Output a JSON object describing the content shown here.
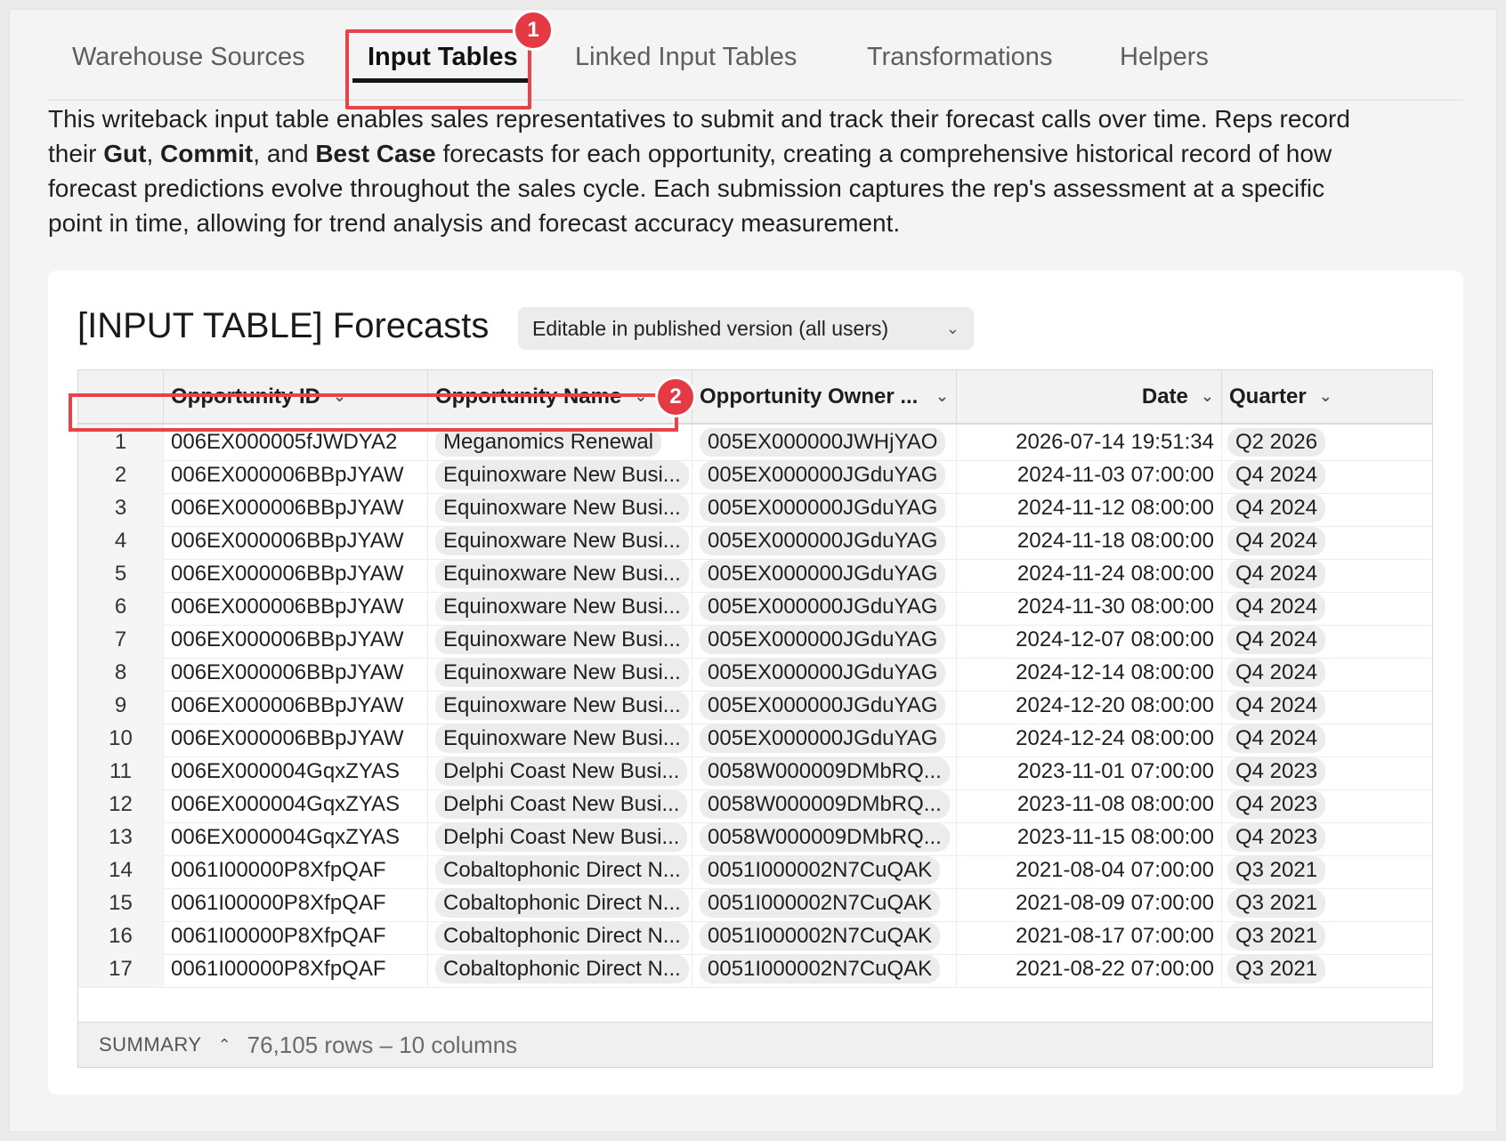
{
  "tabs": [
    {
      "label": "Warehouse Sources"
    },
    {
      "label": "Input Tables"
    },
    {
      "label": "Linked Input Tables"
    },
    {
      "label": "Transformations"
    },
    {
      "label": "Helpers"
    }
  ],
  "annotations": {
    "badge1": "1",
    "badge2": "2"
  },
  "description": {
    "line1": "This writeback input table enables sales representatives to submit and track their forecast calls over time. Reps record",
    "line2_pre": "their ",
    "gut": "Gut",
    "comma": ", ",
    "commit": "Commit",
    "and": ", and ",
    "best_case": "Best Case",
    "line2_post": " forecasts for each opportunity, creating a comprehensive historical record of how",
    "line3": "forecast predictions evolve throughout the sales cycle. Each submission captures the rep's assessment at a specific",
    "line4": "point in time, allowing for trend analysis and forecast accuracy measurement."
  },
  "card": {
    "title": "[INPUT TABLE] Forecasts",
    "permission": "Editable in published version (all users)"
  },
  "table": {
    "columns": [
      "Opportunity ID",
      "Opportunity Name",
      "Opportunity Owner ...",
      "Date",
      "Quarter"
    ],
    "rows": [
      [
        "1",
        "006EX000005fJWDYA2",
        "Meganomics Renewal",
        "005EX000000JWHjYAO",
        "2026-07-14 19:51:34",
        "Q2 2026"
      ],
      [
        "2",
        "006EX000006BBpJYAW",
        "Equinoxware New Busi...",
        "005EX000000JGduYAG",
        "2024-11-03 07:00:00",
        "Q4 2024"
      ],
      [
        "3",
        "006EX000006BBpJYAW",
        "Equinoxware New Busi...",
        "005EX000000JGduYAG",
        "2024-11-12 08:00:00",
        "Q4 2024"
      ],
      [
        "4",
        "006EX000006BBpJYAW",
        "Equinoxware New Busi...",
        "005EX000000JGduYAG",
        "2024-11-18 08:00:00",
        "Q4 2024"
      ],
      [
        "5",
        "006EX000006BBpJYAW",
        "Equinoxware New Busi...",
        "005EX000000JGduYAG",
        "2024-11-24 08:00:00",
        "Q4 2024"
      ],
      [
        "6",
        "006EX000006BBpJYAW",
        "Equinoxware New Busi...",
        "005EX000000JGduYAG",
        "2024-11-30 08:00:00",
        "Q4 2024"
      ],
      [
        "7",
        "006EX000006BBpJYAW",
        "Equinoxware New Busi...",
        "005EX000000JGduYAG",
        "2024-12-07 08:00:00",
        "Q4 2024"
      ],
      [
        "8",
        "006EX000006BBpJYAW",
        "Equinoxware New Busi...",
        "005EX000000JGduYAG",
        "2024-12-14 08:00:00",
        "Q4 2024"
      ],
      [
        "9",
        "006EX000006BBpJYAW",
        "Equinoxware New Busi...",
        "005EX000000JGduYAG",
        "2024-12-20 08:00:00",
        "Q4 2024"
      ],
      [
        "10",
        "006EX000006BBpJYAW",
        "Equinoxware New Busi...",
        "005EX000000JGduYAG",
        "2024-12-24 08:00:00",
        "Q4 2024"
      ],
      [
        "11",
        "006EX000004GqxZYAS",
        "Delphi Coast New Busi...",
        "0058W000009DMbRQ...",
        "2023-11-01 07:00:00",
        "Q4 2023"
      ],
      [
        "12",
        "006EX000004GqxZYAS",
        "Delphi Coast New Busi...",
        "0058W000009DMbRQ...",
        "2023-11-08 08:00:00",
        "Q4 2023"
      ],
      [
        "13",
        "006EX000004GqxZYAS",
        "Delphi Coast New Busi...",
        "0058W000009DMbRQ...",
        "2023-11-15 08:00:00",
        "Q4 2023"
      ],
      [
        "14",
        "0061I00000P8XfpQAF",
        "Cobaltophonic Direct N...",
        "0051I000002N7CuQAK",
        "2021-08-04 07:00:00",
        "Q3 2021"
      ],
      [
        "15",
        "0061I00000P8XfpQAF",
        "Cobaltophonic Direct N...",
        "0051I000002N7CuQAK",
        "2021-08-09 07:00:00",
        "Q3 2021"
      ],
      [
        "16",
        "0061I00000P8XfpQAF",
        "Cobaltophonic Direct N...",
        "0051I000002N7CuQAK",
        "2021-08-17 07:00:00",
        "Q3 2021"
      ],
      [
        "17",
        "0061I00000P8XfpQAF",
        "Cobaltophonic Direct N...",
        "0051I000002N7CuQAK",
        "2021-08-22 07:00:00",
        "Q3 2021"
      ]
    ]
  },
  "summary": {
    "label": "SUMMARY",
    "text": "76,105 rows – 10 columns"
  },
  "colors": {
    "accent_red": "#e8434b",
    "badge_red": "#e53a44"
  }
}
